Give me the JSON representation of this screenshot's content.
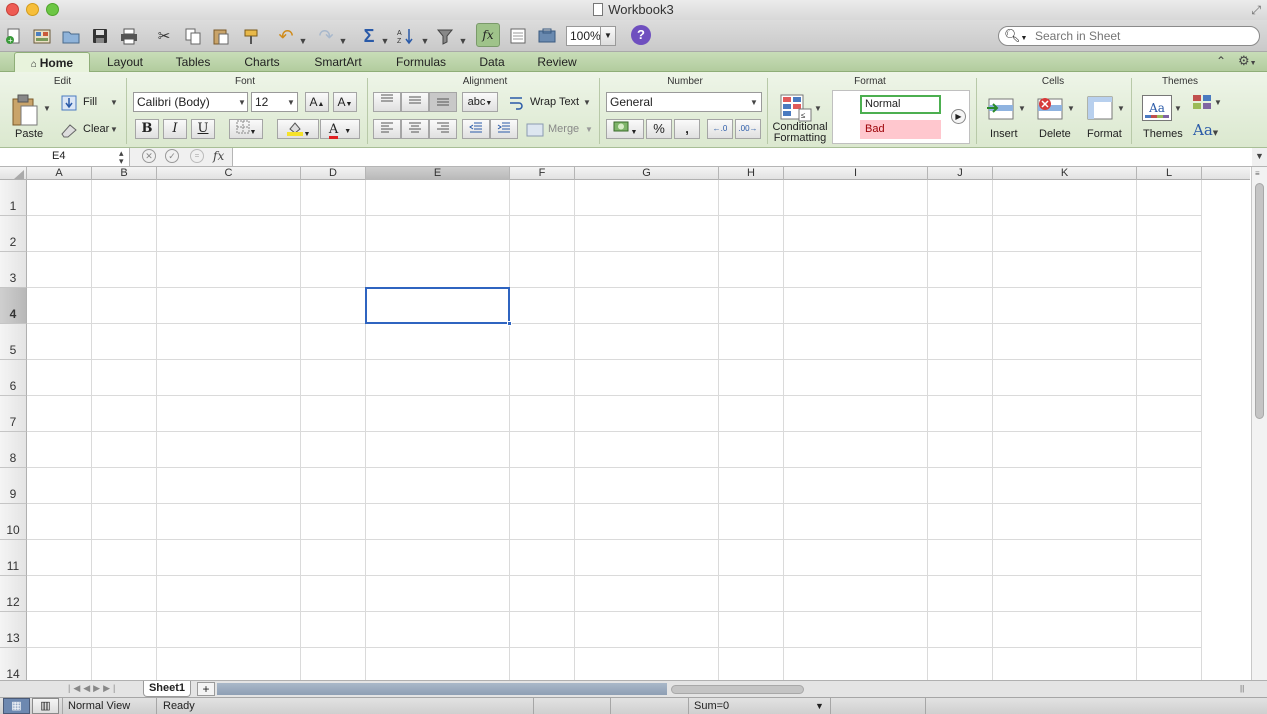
{
  "window": {
    "title": "Workbook3"
  },
  "toolbar": {
    "zoom": "100%",
    "help": "?",
    "fx": "fx",
    "search_placeholder": "Search in Sheet"
  },
  "ribbon_tabs": [
    "Home",
    "Layout",
    "Tables",
    "Charts",
    "SmartArt",
    "Formulas",
    "Data",
    "Review"
  ],
  "groups": {
    "edit": {
      "title": "Edit",
      "paste": "Paste",
      "fill": "Fill",
      "clear": "Clear"
    },
    "font": {
      "title": "Font",
      "font_name": "Calibri (Body)",
      "font_size": "12",
      "bold": "B",
      "italic": "I",
      "underline": "U"
    },
    "alignment": {
      "title": "Alignment",
      "orientation": "abc",
      "wrap_text": "Wrap Text",
      "merge": "Merge"
    },
    "number": {
      "title": "Number",
      "format": "General",
      "percent": "%",
      "comma": ","
    },
    "format": {
      "title": "Format",
      "conditional_line1": "Conditional",
      "conditional_line2": "Formatting",
      "style_normal": "Normal",
      "style_bad": "Bad"
    },
    "cells": {
      "title": "Cells",
      "insert": "Insert",
      "delete": "Delete",
      "format": "Format"
    },
    "themes": {
      "title": "Themes",
      "themes": "Themes",
      "fonts_icon_text": "Aa",
      "theme_icon_text": "Aa"
    }
  },
  "formula_bar": {
    "name_box": "E4",
    "fx": "fx"
  },
  "grid": {
    "columns": [
      "A",
      "B",
      "C",
      "D",
      "E",
      "F",
      "G",
      "H",
      "I",
      "J",
      "K",
      "L"
    ],
    "rows": [
      "1",
      "2",
      "3",
      "4",
      "5",
      "6",
      "7",
      "8",
      "9",
      "10",
      "11",
      "12",
      "13",
      "14"
    ],
    "selected_cell": "E4"
  },
  "sheets": {
    "tabs": [
      "Sheet1"
    ],
    "add": "+"
  },
  "status": {
    "view": "Normal View",
    "state": "Ready",
    "sum": "Sum=0"
  },
  "colors": {
    "ribbon_accent": "#b2cc9e",
    "selection": "#2f64c0",
    "style_bad_bg": "#ffc7ce",
    "style_bad_fg": "#9c0006",
    "normal_border": "#4caf50"
  }
}
